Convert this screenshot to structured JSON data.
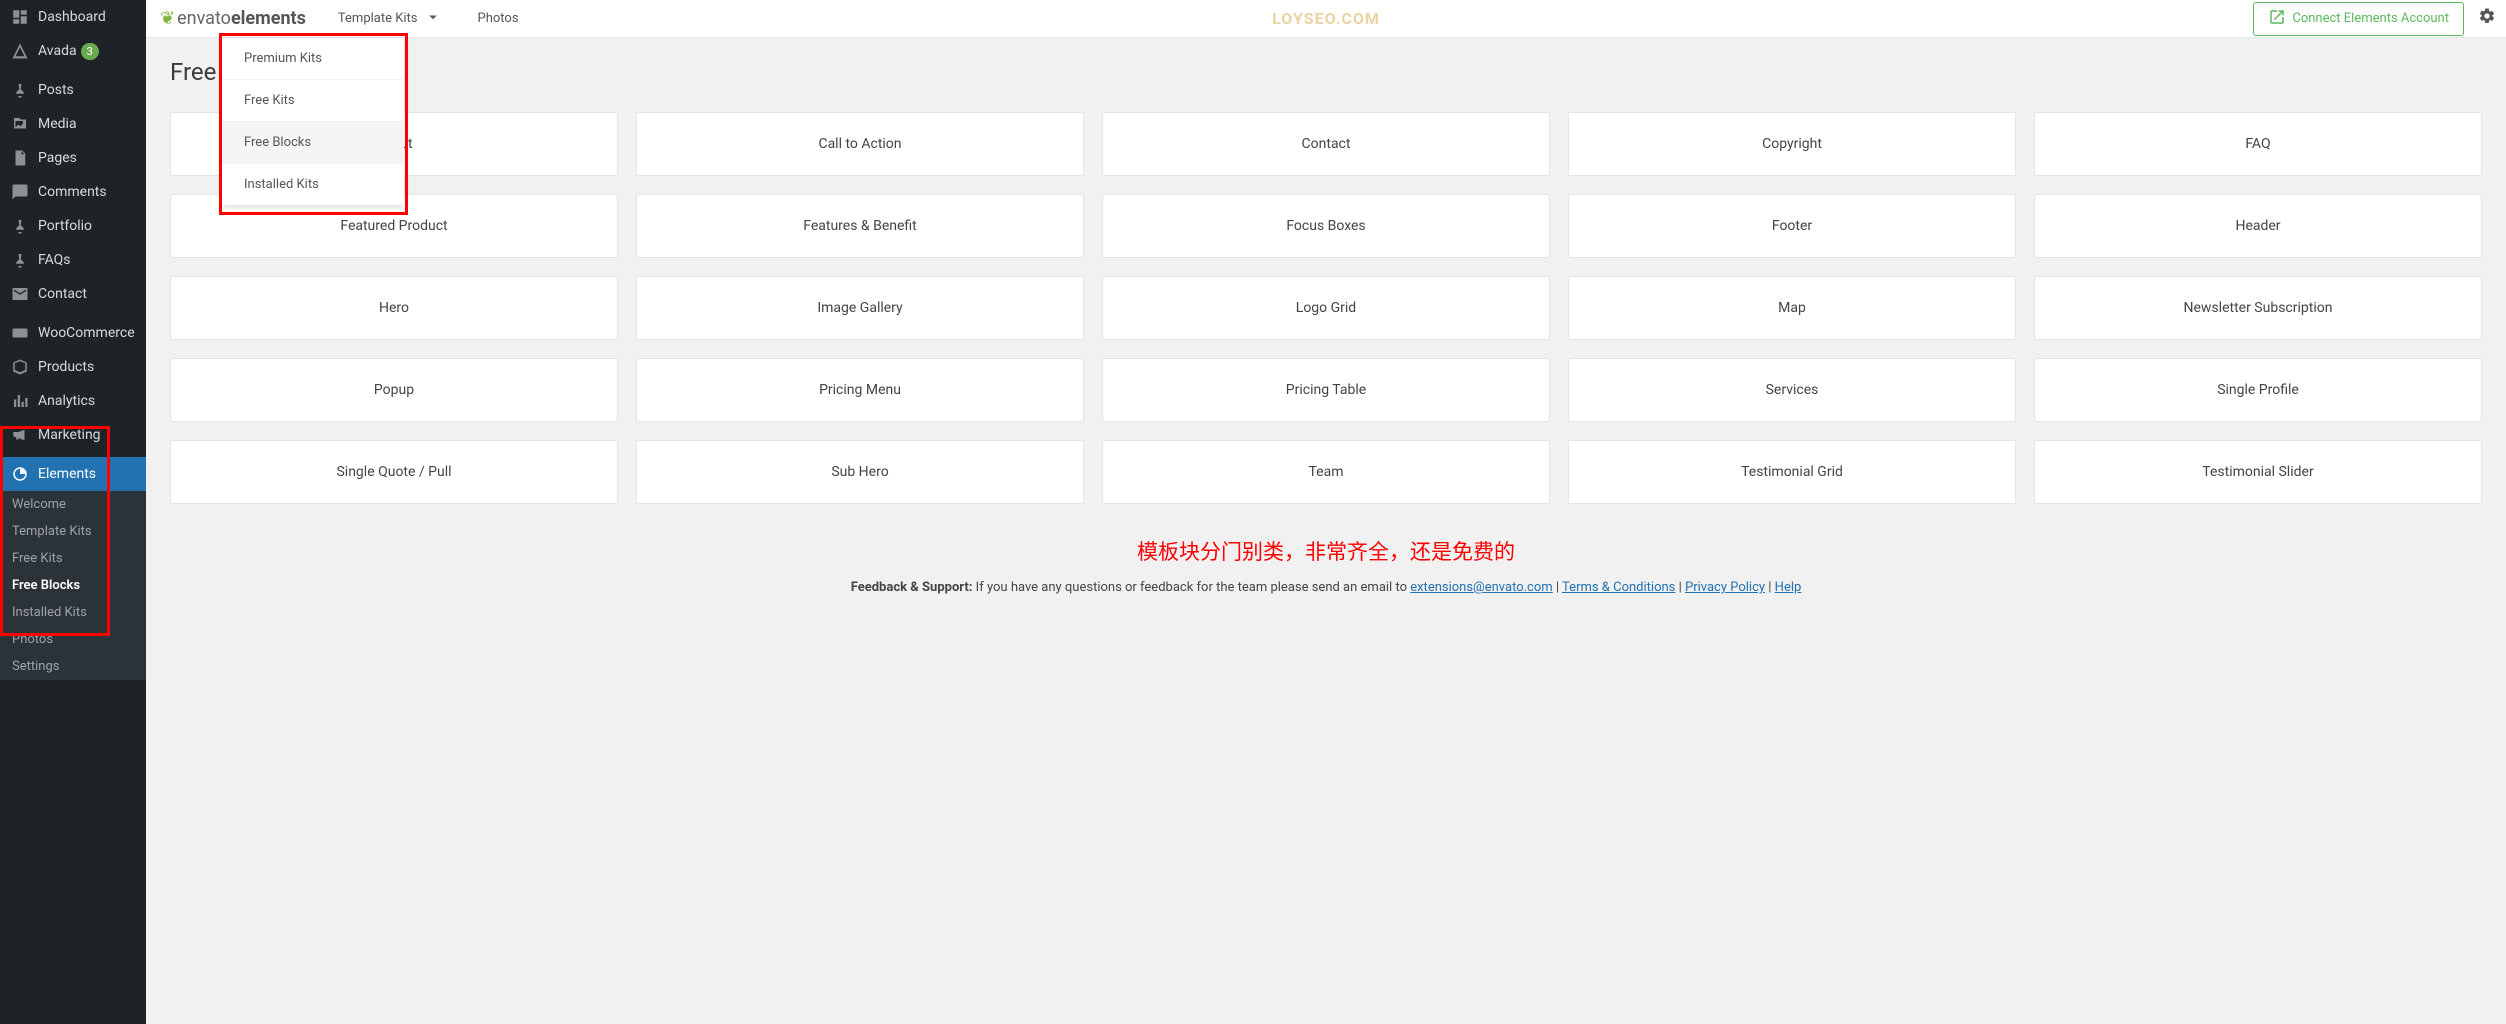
{
  "sidebar": {
    "items": [
      {
        "label": "Dashboard",
        "icon": "dashboard"
      },
      {
        "label": "Avada",
        "icon": "avada",
        "badge": "3"
      },
      {
        "label": "Posts",
        "icon": "pin"
      },
      {
        "label": "Media",
        "icon": "media"
      },
      {
        "label": "Pages",
        "icon": "pages"
      },
      {
        "label": "Comments",
        "icon": "comment"
      },
      {
        "label": "Portfolio",
        "icon": "pin"
      },
      {
        "label": "FAQs",
        "icon": "pin"
      },
      {
        "label": "Contact",
        "icon": "mail"
      },
      {
        "label": "WooCommerce",
        "icon": "woo"
      },
      {
        "label": "Products",
        "icon": "box"
      },
      {
        "label": "Analytics",
        "icon": "analytics"
      },
      {
        "label": "Marketing",
        "icon": "megaphone"
      },
      {
        "label": "Elements",
        "icon": "elements",
        "active": true
      }
    ],
    "submenu": [
      {
        "label": "Welcome"
      },
      {
        "label": "Template Kits"
      },
      {
        "label": "Free Kits"
      },
      {
        "label": "Free Blocks",
        "active": true
      },
      {
        "label": "Installed Kits"
      },
      {
        "label": "Photos"
      },
      {
        "label": "Settings"
      }
    ]
  },
  "topbar": {
    "logo_light": "envato",
    "logo_bold": "elements",
    "tabs": [
      {
        "label": "Template Kits",
        "dropdown": true
      },
      {
        "label": "Photos"
      }
    ],
    "watermark": "LOYSEO.COM",
    "connect_label": "Connect Elements Account"
  },
  "dropdown": {
    "items": [
      {
        "label": "Premium Kits"
      },
      {
        "label": "Free Kits"
      },
      {
        "label": "Free Blocks",
        "highlighted": true
      },
      {
        "label": "Installed Kits"
      }
    ]
  },
  "page": {
    "title": "Free Blocks"
  },
  "cards": [
    "About",
    "Call to Action",
    "Contact",
    "Copyright",
    "FAQ",
    "Featured Product",
    "Features & Benefit",
    "Focus Boxes",
    "Footer",
    "Header",
    "Hero",
    "Image Gallery",
    "Logo Grid",
    "Map",
    "Newsletter Subscription",
    "Popup",
    "Pricing Menu",
    "Pricing Table",
    "Services",
    "Single Profile",
    "Single Quote / Pull",
    "Sub Hero",
    "Team",
    "Testimonial Grid",
    "Testimonial Slider"
  ],
  "annotation": "模板块分门别类，非常齐全，还是免费的",
  "footer": {
    "prefix": "Feedback & Support: ",
    "text": "If you have any questions or feedback for the team please send an email to ",
    "email": "extensions@envato.com",
    "sep1": " | ",
    "terms": "Terms & Conditions",
    "sep2": " | ",
    "privacy": "Privacy Policy",
    "sep3": " | ",
    "help": "Help"
  }
}
